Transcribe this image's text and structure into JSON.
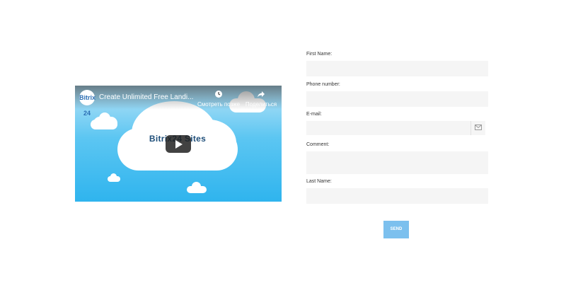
{
  "video": {
    "channel_logo": "Bitrix 24",
    "title": "Create Unlimited Free Landi...",
    "watch_later_label": "Смотреть позже",
    "share_label": "Поделиться",
    "brand_text": "Bitrix24 Sites",
    "icons": {
      "watch_later": "clock-icon",
      "share": "share-icon",
      "play": "play-icon"
    }
  },
  "form": {
    "fields": [
      {
        "label": "First Name:",
        "value": "",
        "type": "text"
      },
      {
        "label": "Phone number:",
        "value": "",
        "type": "text"
      },
      {
        "label": "E-mail:",
        "value": "",
        "type": "email",
        "icon": "envelope-icon"
      },
      {
        "label": "Comment:",
        "value": "",
        "type": "textarea"
      },
      {
        "label": "Last Name:",
        "value": "",
        "type": "text"
      }
    ],
    "submit_label": "SEND"
  },
  "colors": {
    "send_button": "#7cc0ee",
    "input_bg": "#f5f5f5",
    "video_sky": "#2fb4ee"
  }
}
